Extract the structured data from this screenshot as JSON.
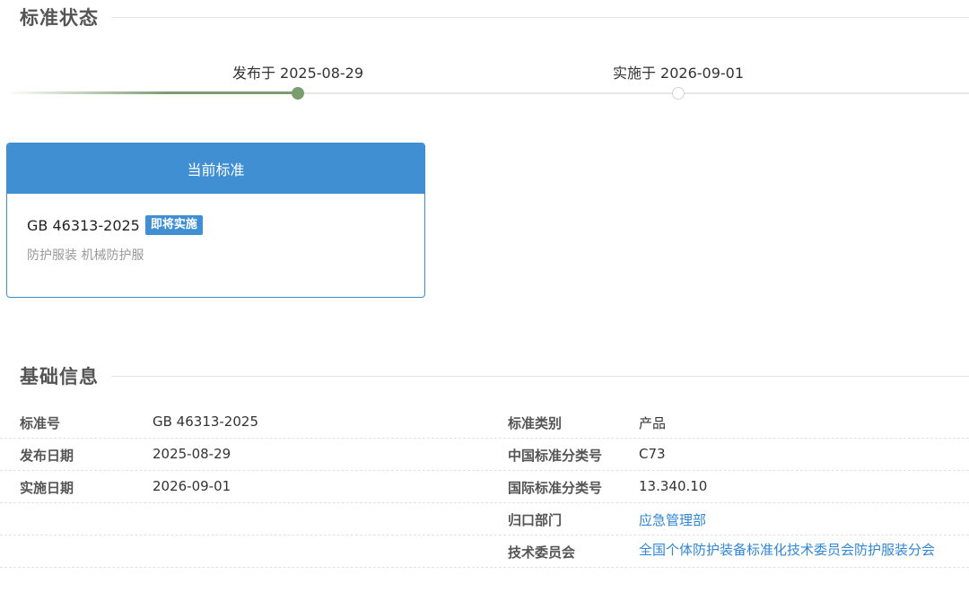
{
  "status_section": {
    "title": "标准状态",
    "timeline": [
      {
        "label": "发布于 2025-08-29",
        "state": "done"
      },
      {
        "label": "实施于 2026-09-01",
        "state": "pending"
      }
    ]
  },
  "current_standard": {
    "header": "当前标准",
    "code": "GB 46313-2025",
    "badge": "即将实施",
    "description": "防护服装 机械防护服"
  },
  "basic_section": {
    "title": "基础信息",
    "rows": [
      {
        "l_label": "标准号",
        "l_value": "GB 46313-2025",
        "r_label": "标准类别",
        "r_value": "产品"
      },
      {
        "l_label": "发布日期",
        "l_value": "2025-08-29",
        "r_label": "中国标准分类号",
        "r_value": "C73"
      },
      {
        "l_label": "实施日期",
        "l_value": "2026-09-01",
        "r_label": "国际标准分类号",
        "r_value": "13.340.10"
      },
      {
        "l_label": "",
        "l_value": "",
        "r_label": "归口部门",
        "r_value": "应急管理部"
      },
      {
        "l_label": "",
        "l_value": "",
        "r_label": "技术委员会",
        "r_value": "全国个体防护装备标准化技术委员会防护服装分会"
      }
    ]
  },
  "colors": {
    "accent_blue": "#3f8fd2",
    "progress_green": "#7a9e6e",
    "link_blue": "#2f86d6"
  }
}
